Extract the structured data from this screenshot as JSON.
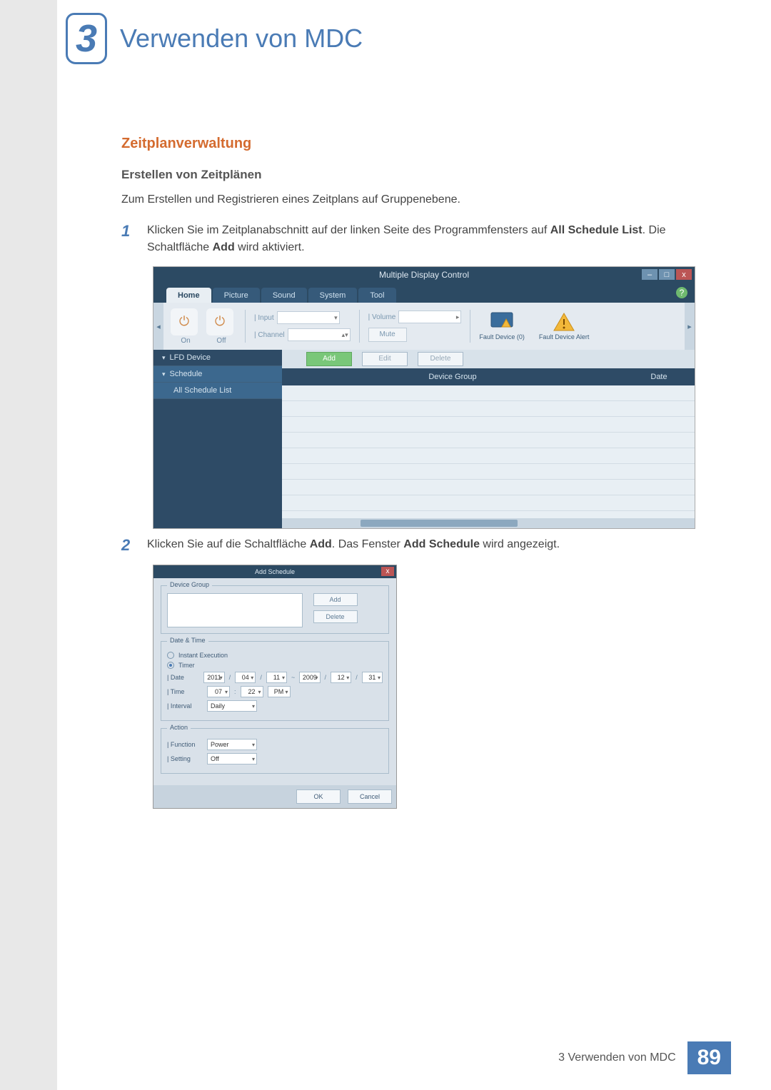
{
  "chapter": {
    "num": "3",
    "title": "Verwenden von MDC"
  },
  "section": {
    "title": "Zeitplanverwaltung",
    "sub": "Erstellen von Zeitplänen",
    "intro": "Zum Erstellen und Registrieren eines Zeitplans auf Gruppenebene."
  },
  "steps": {
    "s1": {
      "num": "1",
      "pre": "Klicken Sie im Zeitplanabschnitt auf der linken Seite des Programmfensters auf ",
      "bold1": "All Schedule List",
      "mid": ". Die Schaltfläche ",
      "bold2": "Add",
      "post": " wird aktiviert."
    },
    "s2": {
      "num": "2",
      "pre": "Klicken Sie auf die Schaltfläche ",
      "bold1": "Add",
      "mid": ". Das Fenster ",
      "bold2": "Add Schedule",
      "post": " wird angezeigt."
    }
  },
  "mdc_window": {
    "title": "Multiple Display Control",
    "winctrl": {
      "min": "–",
      "max": "□",
      "close": "x"
    },
    "tabs": {
      "home": "Home",
      "picture": "Picture",
      "sound": "Sound",
      "system": "System",
      "tool": "Tool"
    },
    "help": "?",
    "toolbar": {
      "scroll_left": "◂",
      "scroll_right": "▸",
      "power_on": "On",
      "power_off": "Off",
      "input_label": "| Input",
      "channel_label": "| Channel",
      "volume_label": "| Volume",
      "mute": "Mute",
      "fault_device": "Fault Device (0)",
      "fault_alert": "Fault Device Alert"
    },
    "side": {
      "lfd": "LFD Device",
      "schedule": "Schedule",
      "all_list": "All Schedule List",
      "tri_down": "▾",
      "tri_right": "▸"
    },
    "buttons": {
      "add": "Add",
      "edit": "Edit",
      "delete": "Delete"
    },
    "cols": {
      "group": "Device Group",
      "date": "Date"
    }
  },
  "add_schedule": {
    "title": "Add Schedule",
    "close": "x",
    "device_group": "Device Group",
    "add": "Add",
    "delete": "Delete",
    "date_time": "Date & Time",
    "instant": "Instant Execution",
    "timer": "Timer",
    "date_label": "| Date",
    "time_label": "| Time",
    "interval_label": "| Interval",
    "date_vals": {
      "y1": "2011",
      "m1": "04",
      "d1": "11",
      "tilde": "~",
      "y2": "2009",
      "m2": "12",
      "d2": "31"
    },
    "time_vals": {
      "h": "07",
      "m": "22",
      "ap": "PM"
    },
    "interval": "Daily",
    "action": "Action",
    "function_label": "| Function",
    "setting_label": "| Setting",
    "function": "Power",
    "setting": "Off",
    "ok": "OK",
    "cancel": "Cancel",
    "slash": "/",
    "spin_caret": "▾"
  },
  "footer": {
    "text": "3 Verwenden von MDC",
    "page": "89"
  }
}
